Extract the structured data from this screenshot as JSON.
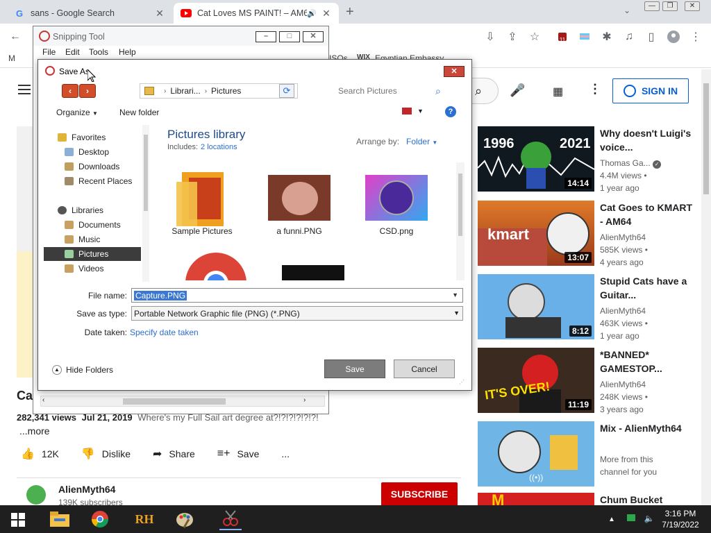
{
  "browser": {
    "tabs": [
      {
        "title": "sans - Google Search",
        "favicon": "G"
      },
      {
        "title": "Cat Loves MS PAINT! – AM64",
        "favicon": "yt"
      }
    ],
    "bookmarks": [
      "M",
      "ISOs",
      "Egyptian Embassy"
    ]
  },
  "youtube": {
    "sign_in": "SIGN IN",
    "video_title": "Ca",
    "views": "282,341 views",
    "date": "Jul 21, 2019",
    "description": "Where's my Full Sail art degree at?!?!?!?!?!?!",
    "more": "...more",
    "actions": {
      "likes": "12K",
      "dislike": "Dislike",
      "share": "Share",
      "save": "Save",
      "more": "..."
    },
    "channel": {
      "name": "AlienMyth64",
      "subs": "139K subscribers",
      "subscribe": "SUBSCRIBE"
    },
    "recommendations": [
      {
        "title": "Why doesn't Luigi's voice...",
        "channel": "Thomas Ga...",
        "views": "4.4M views •",
        "age": "1 year ago",
        "duration": "14:14",
        "thumb_text": "1996 2021"
      },
      {
        "title": "Cat Goes to KMART - AM64",
        "channel": "AlienMyth64",
        "views": "585K views •",
        "age": "4 years ago",
        "duration": "13:07",
        "thumb_text": "kmart"
      },
      {
        "title": "Stupid Cats have a Guitar...",
        "channel": "AlienMyth64",
        "views": "463K views •",
        "age": "1 year ago",
        "duration": "8:12"
      },
      {
        "title": "*BANNED* GAMESTOP...",
        "channel": "AlienMyth64",
        "views": "248K views •",
        "age": "3 years ago",
        "duration": "11:19",
        "thumb_text": "IT'S OVER!"
      },
      {
        "title": "Mix - AlienMyth64",
        "text": "More from this channel for you"
      },
      {
        "title": "Chum Bucket"
      }
    ]
  },
  "snipping_tool": {
    "title": "Snipping Tool",
    "menu": [
      "File",
      "Edit",
      "Tools",
      "Help"
    ]
  },
  "save_dialog": {
    "title": "Save As",
    "breadcrumb": [
      "Librari...",
      "Pictures"
    ],
    "search_placeholder": "Search Pictures",
    "organize": "Organize",
    "new_folder": "New folder",
    "nav": {
      "favorites": "Favorites",
      "desktop": "Desktop",
      "downloads": "Downloads",
      "recent": "Recent Places",
      "libraries": "Libraries",
      "documents": "Documents",
      "music": "Music",
      "pictures": "Pictures",
      "videos": "Videos"
    },
    "library_title": "Pictures library",
    "includes": "Includes:",
    "locations": "2 locations",
    "arrange_by": "Arrange by:",
    "arrange_value": "Folder",
    "files": [
      "Sample Pictures",
      "a funni.PNG",
      "CSD.png"
    ],
    "file_name_label": "File name:",
    "file_name": "Capture.PNG",
    "save_type_label": "Save as type:",
    "save_type": "Portable Network Graphic file (PNG) (*.PNG)",
    "date_label": "Date taken:",
    "date_link": "Specify date taken",
    "hide_folders": "Hide Folders",
    "save": "Save",
    "cancel": "Cancel"
  },
  "taskbar": {
    "time": "3:16 PM",
    "date": "7/19/2022",
    "rh_label": "RH"
  }
}
